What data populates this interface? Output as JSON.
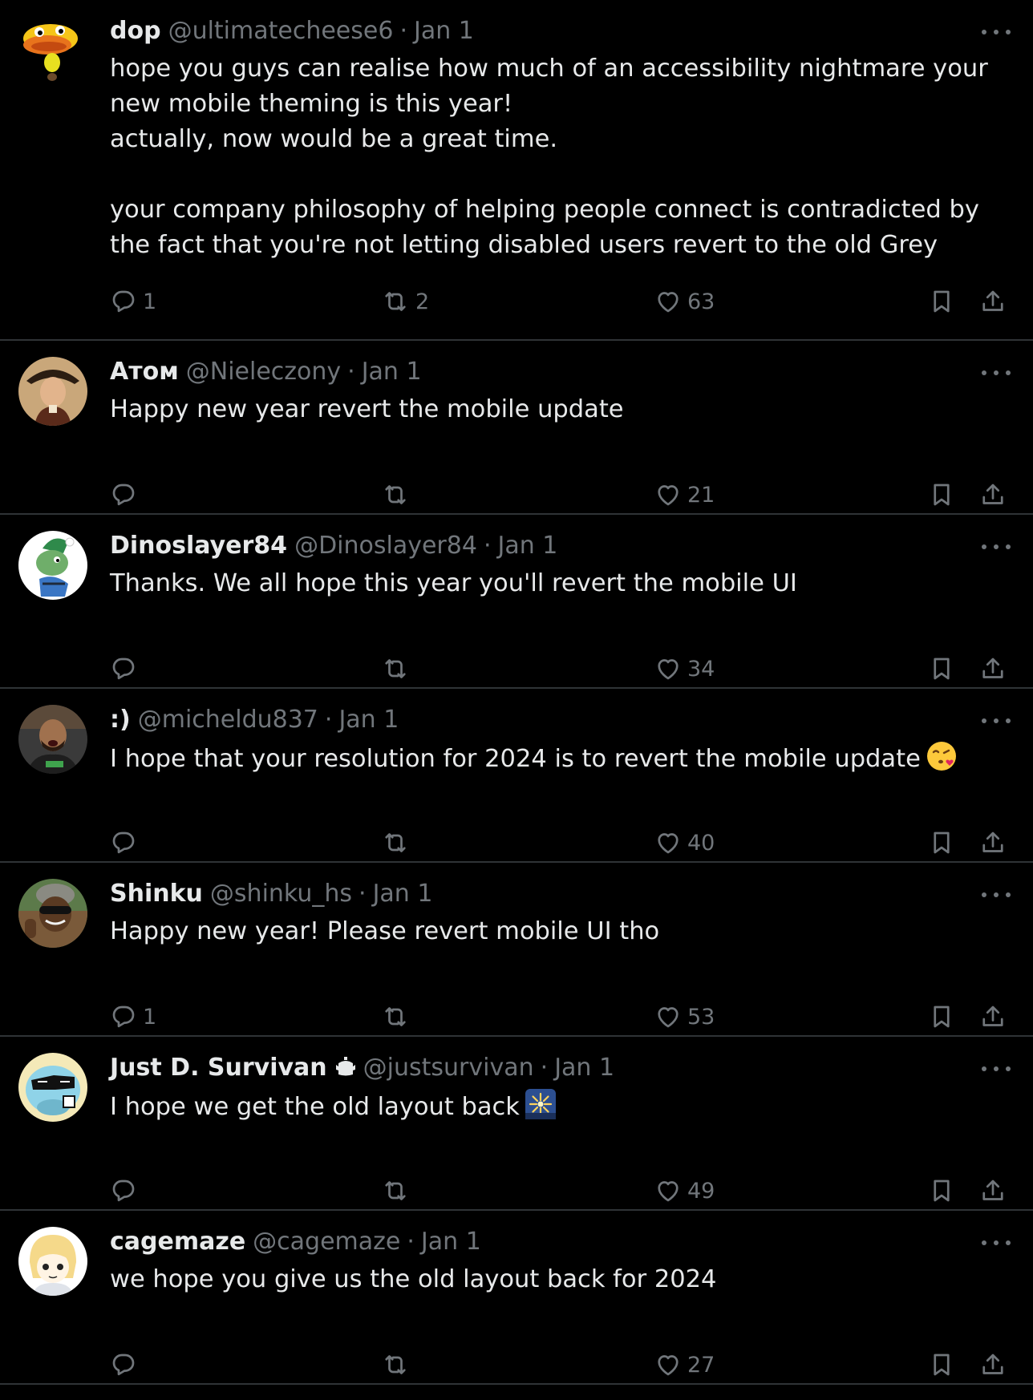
{
  "colors": {
    "background": "#000000",
    "text_primary": "#e7e9ea",
    "text_secondary": "#71767b",
    "divider": "#2f3336"
  },
  "icons": {
    "reply": "reply-icon",
    "retweet": "retweet-icon",
    "like": "heart-icon",
    "bookmark": "bookmark-icon",
    "share": "share-icon",
    "more": "more-icon"
  },
  "tweets": [
    {
      "name": "dop",
      "handle": "@ultimatecheese6",
      "separator": "·",
      "date": "Jan 1",
      "text": "hope you guys can realise how much of an accessibility nightmare your new mobile theming is this year!\nactually, now would be a great time.\n\nyour company philosophy of helping people connect is contradicted by the fact that you're not letting disabled users revert to the old Grey",
      "replies": "1",
      "retweets": "2",
      "likes": "63"
    },
    {
      "name": "Атом",
      "handle": "@Nieleczony",
      "separator": "·",
      "date": "Jan 1",
      "text": "Happy new year revert the mobile update",
      "replies": "",
      "retweets": "",
      "likes": "21"
    },
    {
      "name": "Dinoslayer84",
      "handle": "@Dinoslayer84",
      "separator": "·",
      "date": "Jan 1",
      "text": "Thanks. We all hope this year you'll revert the mobile UI",
      "replies": "",
      "retweets": "",
      "likes": "34"
    },
    {
      "name": ":)",
      "handle": "@micheldu837",
      "separator": "·",
      "date": "Jan 1",
      "text": "I hope that your resolution for 2024 is to revert the mobile update",
      "emoji": "face-blowing-kiss-emoji",
      "replies": "",
      "retweets": "",
      "likes": "40"
    },
    {
      "name": "Shinku",
      "handle": "@shinku_hs",
      "separator": "·",
      "date": "Jan 1",
      "text": "Happy new year! Please revert mobile UI tho",
      "replies": "1",
      "retweets": "",
      "likes": "53"
    },
    {
      "name": "Just D. Survivan",
      "handle": "@justsurvivan",
      "separator": "·",
      "date": "Jan 1",
      "text": "I hope we get the old layout back",
      "emoji": "fireworks-emoji",
      "replies": "",
      "retweets": "",
      "likes": "49"
    },
    {
      "name": "cagemaze",
      "handle": "@cagemaze",
      "separator": "·",
      "date": "Jan 1",
      "text": "we hope you give us the old layout back for 2024",
      "replies": "",
      "retweets": "",
      "likes": "27"
    }
  ]
}
